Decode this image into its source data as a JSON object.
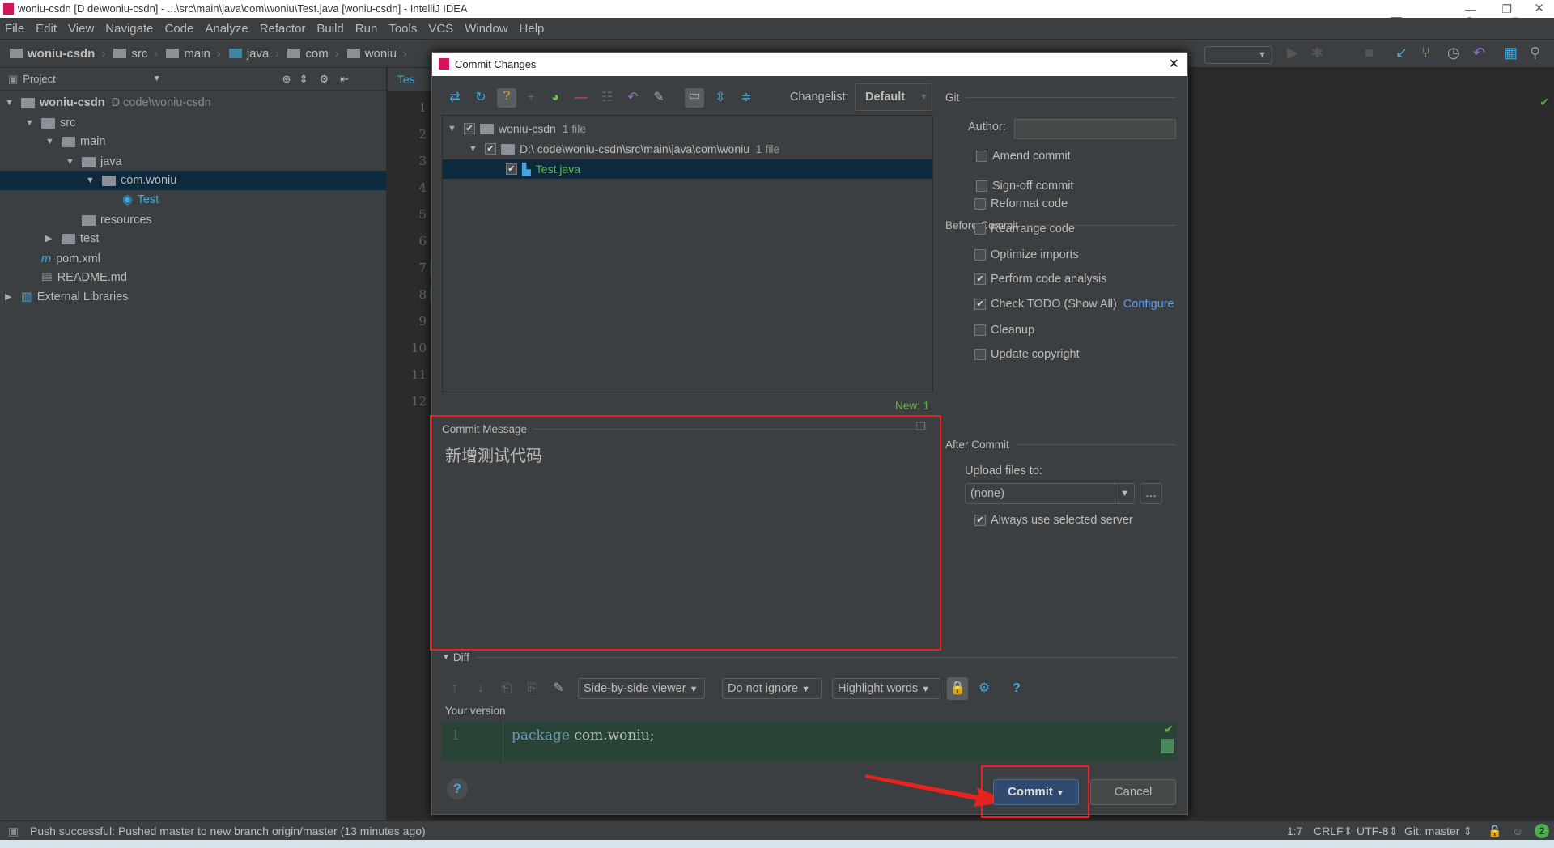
{
  "window": {
    "title": "woniu-csdn [D                    de\\woniu-csdn] - ...\\src\\main\\java\\com\\woniu\\Test.java [woniu-csdn] - IntelliJ IDEA"
  },
  "menu": [
    "File",
    "Edit",
    "View",
    "Navigate",
    "Code",
    "Analyze",
    "Refactor",
    "Build",
    "Run",
    "Tools",
    "VCS",
    "Window",
    "Help"
  ],
  "breadcrumb": [
    "woniu-csdn",
    "src",
    "main",
    "java",
    "com",
    "woniu"
  ],
  "project_panel": {
    "title": "Project",
    "tree": [
      {
        "label": "woniu-csdn",
        "extra": "D                    code\\woniu-csdn",
        "indent": 0,
        "arrow": "▼",
        "bold": true
      },
      {
        "label": "src",
        "indent": 1,
        "arrow": "▼"
      },
      {
        "label": "main",
        "indent": 2,
        "arrow": "▼"
      },
      {
        "label": "java",
        "indent": 3,
        "arrow": "▼"
      },
      {
        "label": "com.woniu",
        "indent": 4,
        "arrow": "▼",
        "selected": true
      },
      {
        "label": "Test",
        "indent": 5,
        "arrow": ""
      },
      {
        "label": "resources",
        "indent": 3,
        "arrow": ""
      },
      {
        "label": "test",
        "indent": 2,
        "arrow": "▶"
      },
      {
        "label": "pom.xml",
        "indent": 1,
        "arrow": ""
      },
      {
        "label": "README.md",
        "indent": 1,
        "arrow": ""
      },
      {
        "label": "External Libraries",
        "indent": 0,
        "arrow": "▶"
      }
    ]
  },
  "editor": {
    "tab": "Tes",
    "line_numbers": [
      "1",
      "2",
      "3",
      "4",
      "5",
      "6",
      "7",
      "8",
      "9",
      "10",
      "11",
      "12"
    ]
  },
  "dialog": {
    "title": "Commit Changes",
    "changelist_label": "Changelist:",
    "changelist_value": "Default",
    "changes": [
      {
        "label": "woniu-csdn",
        "count": "1 file"
      },
      {
        "label": "D:\\                    code\\woniu-csdn\\src\\main\\java\\com\\woniu",
        "count": "1 file"
      },
      {
        "label": "Test.java"
      }
    ],
    "new_count": "New: 1",
    "commit_message_label": "Commit Message",
    "commit_message": "新增测试代码",
    "git": {
      "title": "Git",
      "author_label": "Author:",
      "author_value": "",
      "amend": "Amend commit",
      "signoff": "Sign-off commit"
    },
    "before_commit": {
      "title": "Before Commit",
      "items": [
        {
          "label": "Reformat code",
          "checked": false
        },
        {
          "label": "Rearrange code",
          "checked": false
        },
        {
          "label": "Optimize imports",
          "checked": false
        },
        {
          "label": "Perform code analysis",
          "checked": true
        },
        {
          "label": "Check TODO (Show All)",
          "checked": true,
          "link": "Configure"
        },
        {
          "label": "Cleanup",
          "checked": false
        },
        {
          "label": "Update copyright",
          "checked": false
        }
      ]
    },
    "after_commit": {
      "title": "After Commit",
      "upload_label": "Upload files to:",
      "upload_value": "(none)",
      "always_label": "Always use selected server",
      "always_checked": true
    },
    "diff": {
      "title": "Diff",
      "viewer": "Side-by-side viewer",
      "ignore": "Do not ignore",
      "highlight": "Highlight words",
      "your_version": "Your version",
      "code_line_no": "1",
      "code_keyword": "package",
      "code_rest": " com.woniu;"
    },
    "commit_button": "Commit",
    "cancel_button": "Cancel"
  },
  "status": {
    "message": "Push successful: Pushed master to new branch origin/master (13 minutes ago)",
    "position": "1:7",
    "line_sep": "CRLF",
    "encoding": "UTF-8",
    "vcs": "Git: master",
    "notifications": "2"
  },
  "colors": {
    "accent": "#4a88c7",
    "highlight_red": "#e8221c",
    "added_green": "#294436"
  }
}
